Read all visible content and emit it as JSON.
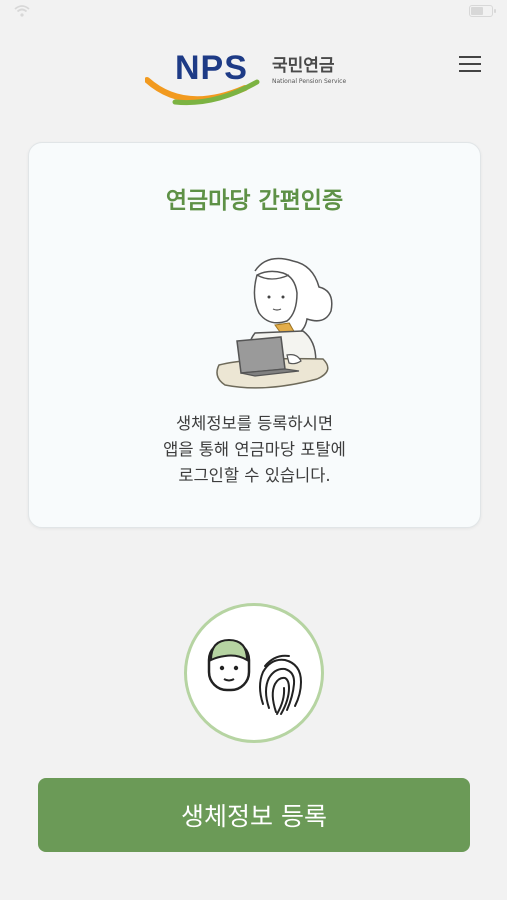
{
  "status_bar": {
    "carrier": "",
    "time": "",
    "battery_level": 0.65
  },
  "header": {
    "logo_wordmark": "NPS",
    "logo_korean": "국민연금",
    "logo_english": "National Pension Service",
    "menu_icon": "hamburger-menu-icon"
  },
  "card": {
    "title": "연금마당 간편인증",
    "illustration": "person-with-laptop",
    "description": [
      "생체정보를 등록하시면",
      "앱을 통해 연금마당 포탈에",
      "로그인할 수 있습니다."
    ]
  },
  "biometric": {
    "icons": [
      "face-icon",
      "fingerprint-icon"
    ]
  },
  "register_button": {
    "label": "생체정보 등록"
  },
  "colors": {
    "accent_green": "#6b9a57",
    "title_green": "#5e9146",
    "logo_blue": "#1e3b86",
    "circle_border": "#b6d4a2",
    "background": "#f2f2f2"
  }
}
